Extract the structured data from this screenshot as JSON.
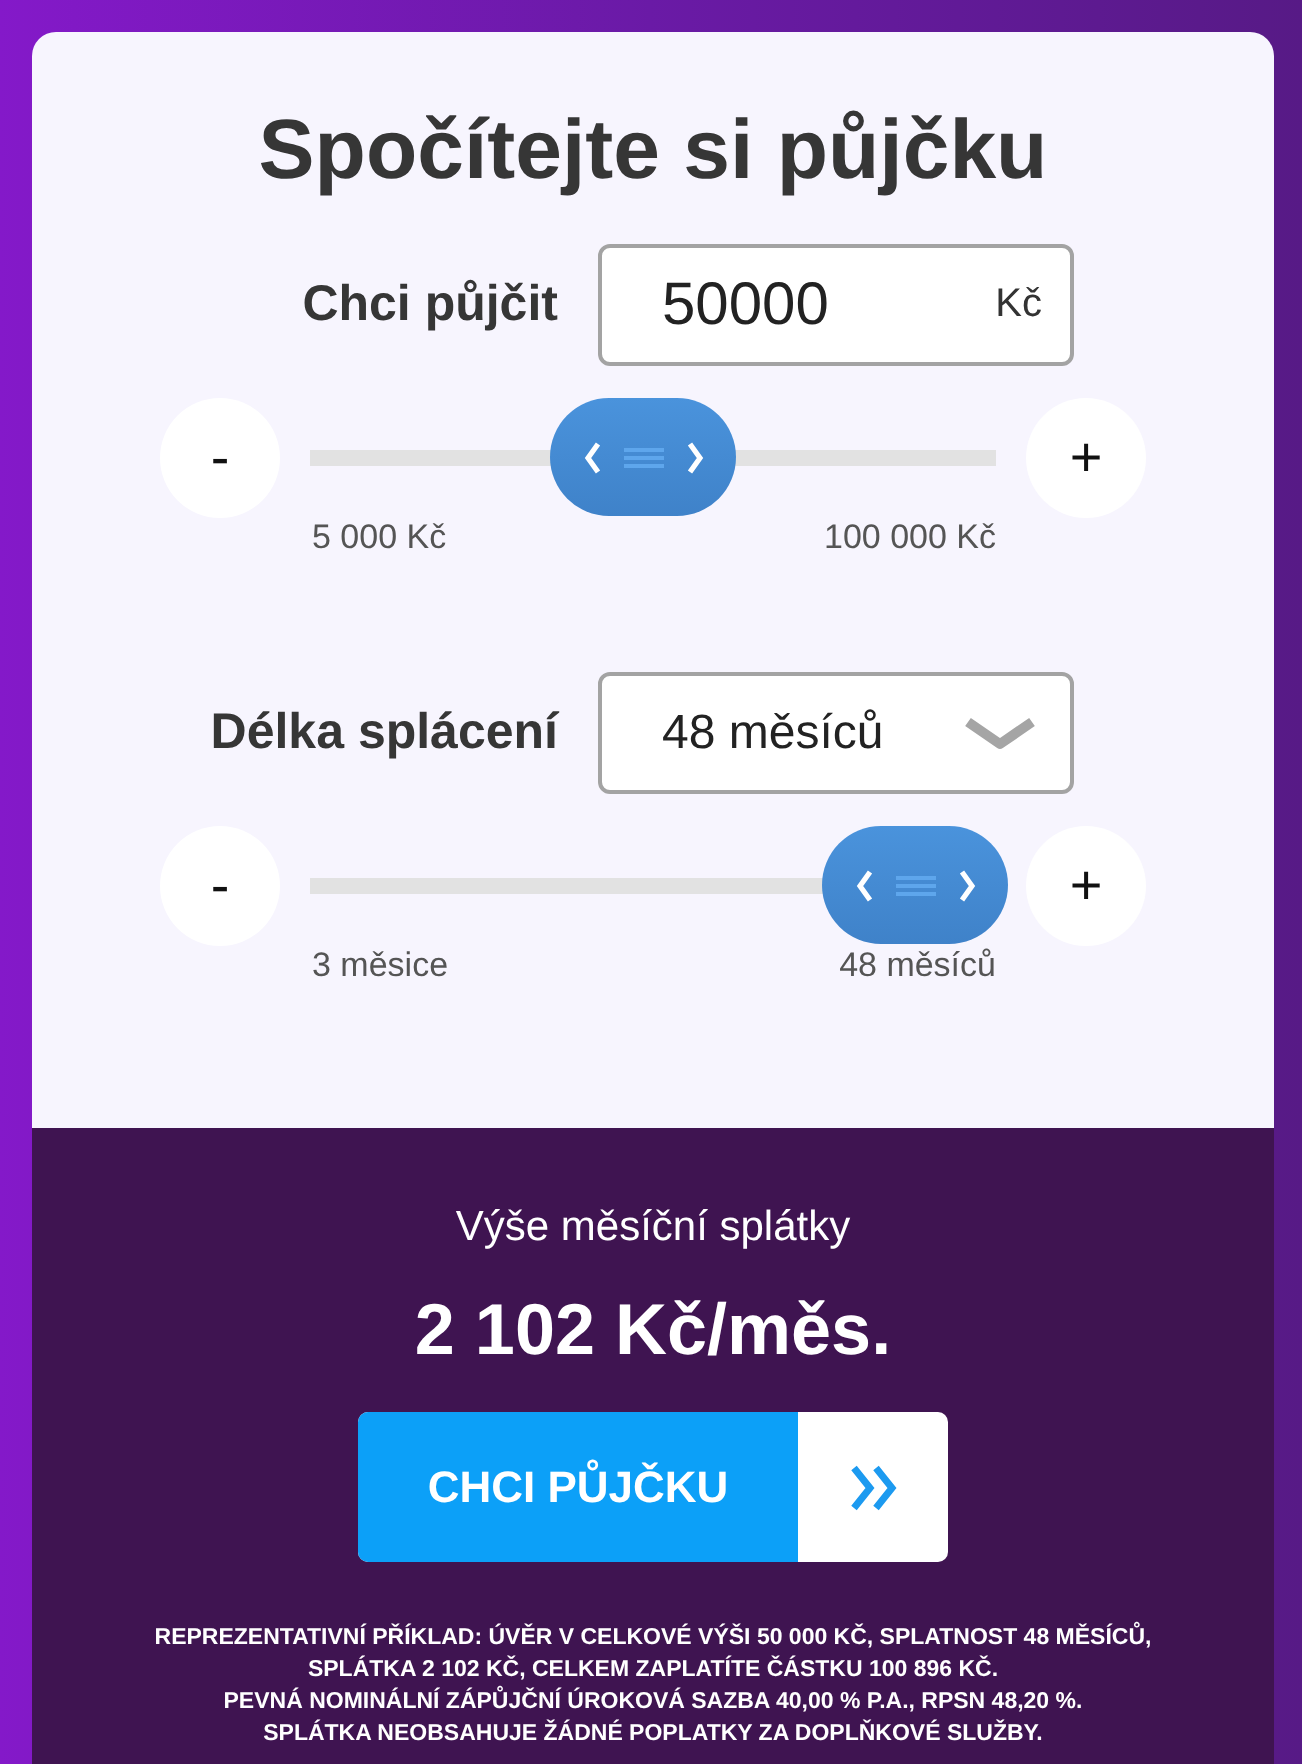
{
  "title": "Spočítejte si půjčku",
  "fields": [
    {
      "kind": "input",
      "label": "Chci půjčit",
      "value": "50000",
      "unit": "Kč",
      "slider": {
        "minus": "-",
        "plus": "+",
        "level": 0.47,
        "min_label": "5 000 Kč",
        "max_label": "100 000 Kč"
      }
    },
    {
      "kind": "select",
      "label": "Délka splácení",
      "value": "48 měsíců",
      "slider": {
        "minus": "-",
        "plus": "+",
        "level": 1,
        "min_label": "3 měsice",
        "max_label": "48 měsíců"
      }
    }
  ],
  "result": {
    "label": "Výše měsíční splátky",
    "value": "2 102 Kč/měs."
  },
  "cta_button": {
    "label": "CHCI PŮJČKU"
  },
  "disclaimer_lines": [
    "REPREZENTATIVNÍ PŘÍKLAD: ÚVĚR V CELKOVÉ VÝŠI 50 000 KČ, SPLATNOST 48 MĚSÍCŮ,",
    "SPLÁTKA 2 102 KČ, CELKEM ZAPLATÍTE ČÁSTKU 100 896 KČ.",
    "PEVNÁ NOMINÁLNÍ ZÁPŮJČNÍ ÚROKOVÁ SAZBA 40,00 % P.A., RPSN 48,20 %.",
    "SPLÁTKA NEOBSAHUJE ŽÁDNÉ POPLATKY ZA DOPLŇKOVÉ SLUŽBY."
  ]
}
